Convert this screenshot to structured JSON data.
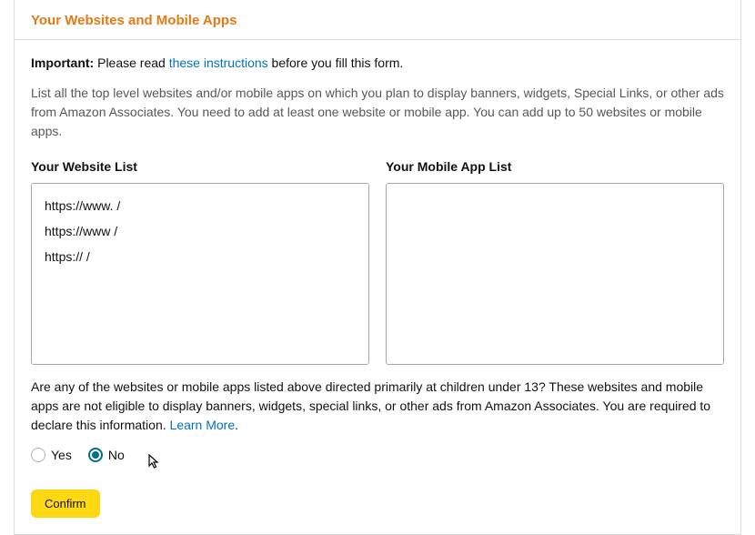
{
  "page_title": "Your Websites and Mobile Apps",
  "intro": {
    "important_label": "Important:",
    "before_link": " Please read ",
    "instructions_link": "these instructions",
    "after_link": " before you fill this form."
  },
  "description": "List all the top level websites and/or mobile apps on which you plan to display banners, widgets, Special Links, or other ads from Amazon Associates. You need to add at least one website or mobile app. You can add up to 50 websites or mobile apps.",
  "website_list": {
    "label": "Your Website List",
    "items": [
      "https://www.                              /",
      "https://www                            /",
      "https://                               /"
    ]
  },
  "mobile_list": {
    "label": "Your Mobile App List",
    "items": []
  },
  "question": {
    "text": "Are any of the websites or mobile apps listed above directed primarily at children under 13? These websites and mobile apps are not eligible to display banners, widgets, special links, or other ads from Amazon Associates. You are required to declare this information. ",
    "learn_more": "Learn More",
    "period": "."
  },
  "radio": {
    "yes": "Yes",
    "no": "No",
    "selected": "no"
  },
  "confirm_label": "Confirm"
}
